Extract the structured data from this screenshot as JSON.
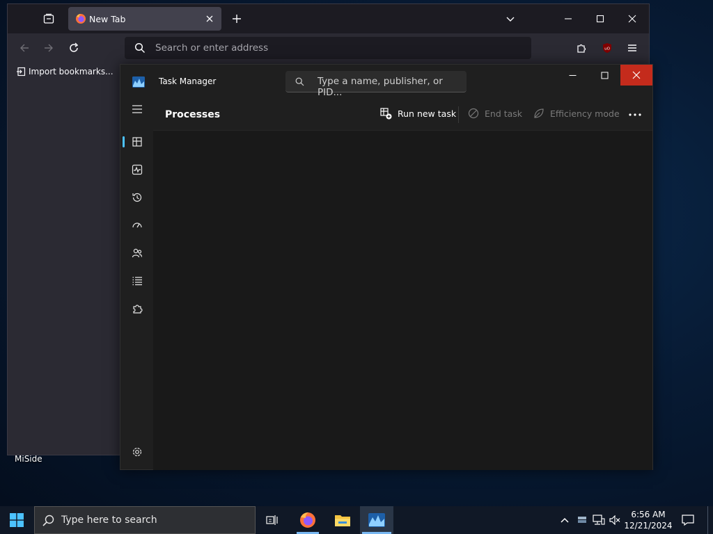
{
  "desktop": {
    "icon_label": "MiSide"
  },
  "firefox": {
    "tab_title": "New Tab",
    "url_placeholder": "Search or enter address",
    "bookmark_import_label": "Import bookmarks..."
  },
  "task_manager": {
    "title": "Task Manager",
    "search_placeholder": "Type a name, publisher, or PID...",
    "page_title": "Processes",
    "commands": {
      "run_new_task": "Run new task",
      "end_task": "End task",
      "efficiency_mode": "Efficiency mode"
    },
    "rail": [
      "processes",
      "performance",
      "app-history",
      "startup-apps",
      "users",
      "details",
      "services",
      "settings"
    ],
    "accent_color": "#4cc2ff",
    "close_color": "#c42b1c"
  },
  "taskbar": {
    "search_placeholder": "Type here to search",
    "time": "6:56 AM",
    "date": "12/21/2024"
  }
}
